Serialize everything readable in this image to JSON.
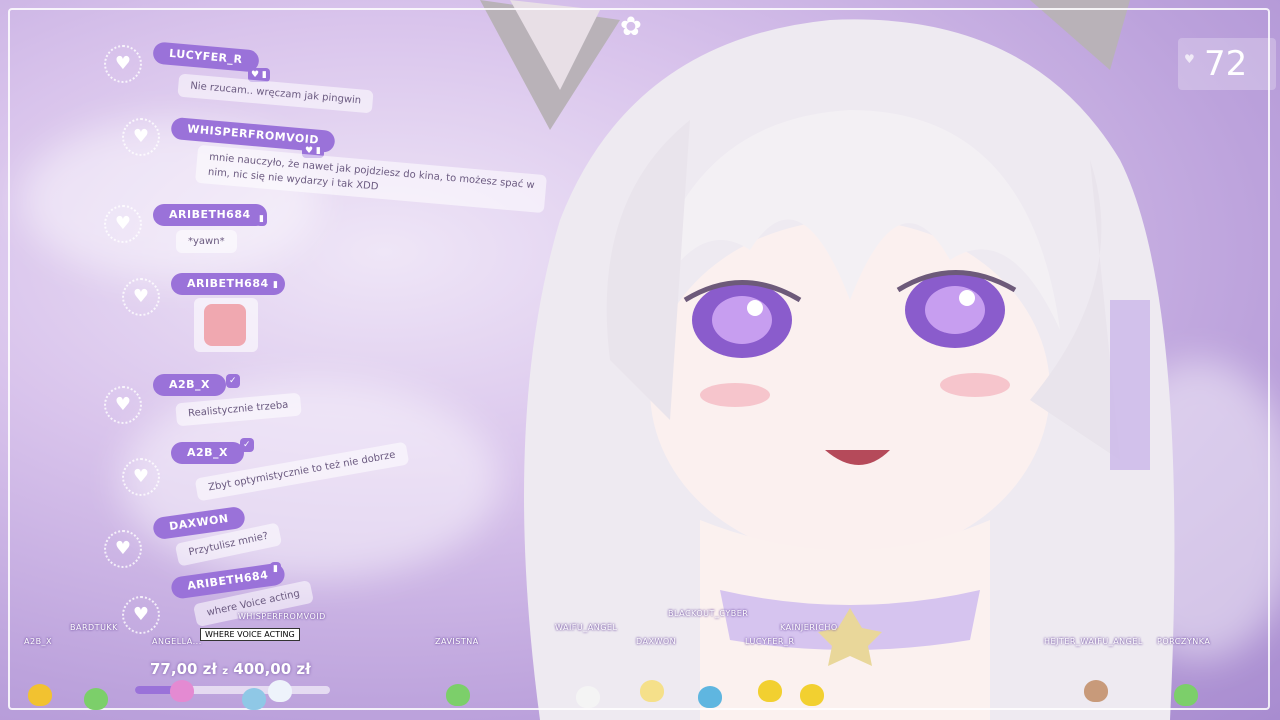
{
  "counter": {
    "value": "72"
  },
  "chat": [
    {
      "user": "LUCYFER_R",
      "text": "Nie rzucam.. wręczam jak pingwin"
    },
    {
      "user": "WHISPERFROMVOID",
      "text": "mnie nauczyło, że nawet jak pojdziesz do kina, to możesz spać w",
      "text2": "nim, nic się nie wydarzy i tak XDD"
    },
    {
      "user": "ARIBETH684",
      "text": "*yawn*"
    },
    {
      "user": "ARIBETH684",
      "text": ""
    },
    {
      "user": "A2B_X",
      "text": "Realistycznie trzeba"
    },
    {
      "user": "A2B_X",
      "text": "Zbyt optymistycznie to też nie dobrze"
    },
    {
      "user": "DAXWON",
      "text": "Przytulisz mnie?"
    },
    {
      "user": "ARIBETH684",
      "text": "where Voice acting"
    }
  ],
  "viewers": [
    "A2B_X",
    "BARDTUKK",
    "ANGELLA...",
    "WHISPERFROMVOID",
    "ZAVISTNA",
    "WAIFU_ANGEL",
    "DAXWON",
    "BLACKOUT_CYBER",
    "LUCYFER_R",
    "KAINJERICHO",
    "HEJTER_WAIFU_ANGEL",
    "PORCZYNKA"
  ],
  "tooltip": "WHERE VOICE ACTING",
  "goal": {
    "current": "77,00 zł",
    "sep": "z",
    "target": "400,00 zł",
    "progress": 0.19
  },
  "colors": {
    "accent": "#9a72d9",
    "background": "#c8b0e4"
  }
}
